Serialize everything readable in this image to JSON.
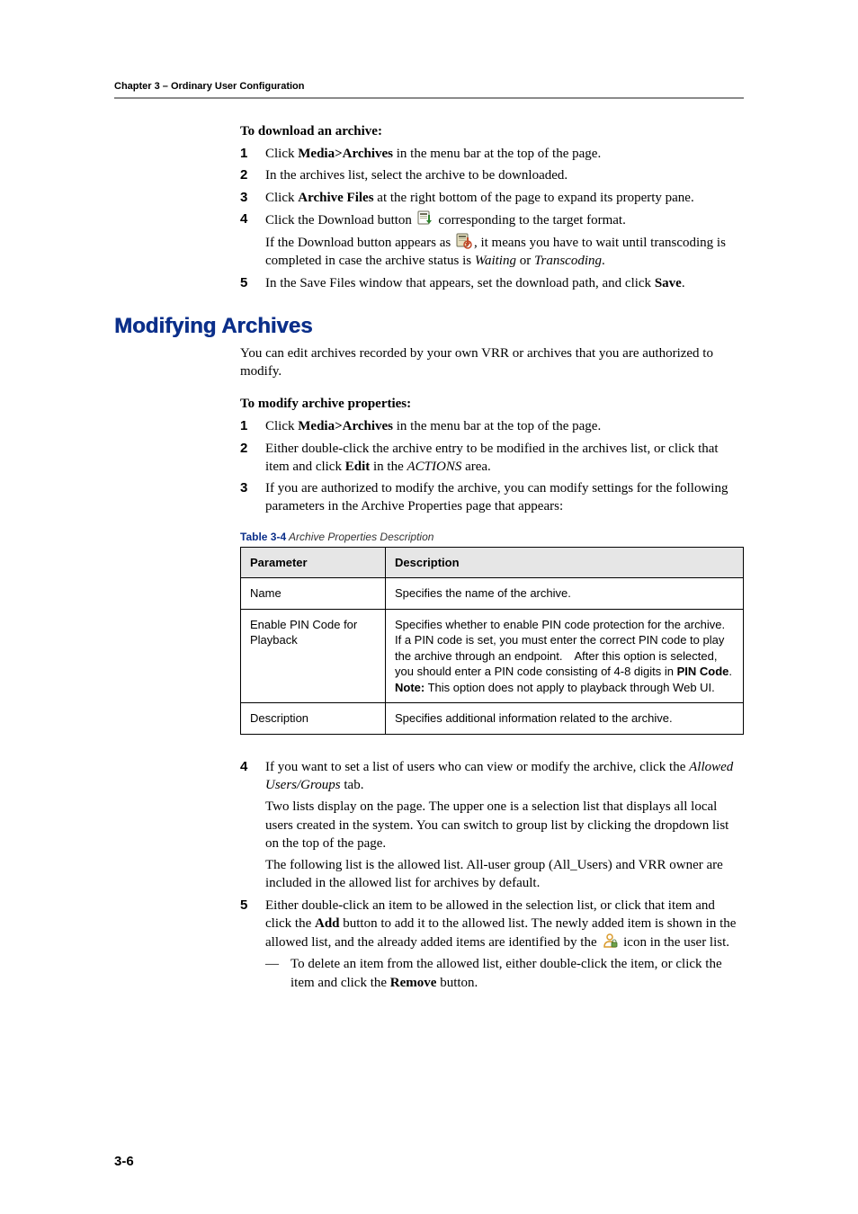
{
  "header": {
    "running": "Chapter 3 – Ordinary User Configuration"
  },
  "section1": {
    "lead": "To download an archive:",
    "steps": [
      {
        "num": "1",
        "html": "Click <b>Media>Archives</b> in the menu bar at the top of the page."
      },
      {
        "num": "2",
        "html": "In the archives list, select the archive to be downloaded."
      },
      {
        "num": "3",
        "html": "Click <b>Archive Files</b> at the right bottom of the page to expand its property pane."
      },
      {
        "num": "4",
        "html": "Click the Download button {DL_ICON} corresponding to the target format.",
        "extra": "If the Download button appears as {DL_DIS_ICON}, it means you have to wait until transcoding is completed in case the archive status is <i>Waiting</i> or <i>Transcoding</i>."
      },
      {
        "num": "5",
        "html": "In the Save Files window that appears, set the download path, and click <b>Save</b>."
      }
    ]
  },
  "section2": {
    "title": "Modifying Archives",
    "intro": "You can edit archives recorded by your own VRR or archives that you are authorized to modify.",
    "lead": "To modify archive properties:",
    "steps_a": [
      {
        "num": "1",
        "html": "Click <b>Media>Archives</b> in the menu bar at the top of the page."
      },
      {
        "num": "2",
        "html": "Either double-click the archive entry to be modified in the archives list, or click that item and click <b>Edit</b> in the <i>ACTIONS</i> area."
      },
      {
        "num": "3",
        "html": "If you are authorized to modify the archive, you can modify settings for the following parameters in the Archive Properties page that appears:"
      }
    ],
    "table": {
      "caption_strong": "Table 3-4",
      "caption_rest": " Archive Properties Description",
      "headers": [
        "Parameter",
        "Description"
      ],
      "rows": [
        [
          "Name",
          "Specifies the name of the archive."
        ],
        [
          "Enable PIN Code for Playback",
          "Specifies whether to enable PIN code protection for the archive. If a PIN code is set, you must enter the correct PIN code to play the archive through an endpoint. After this option is selected, you should enter a PIN code consisting of 4-8 digits in <b>PIN Code</b>.<br><b>Note:</b> This option does not apply to playback through Web UI."
        ],
        [
          "Description",
          "Specifies additional information related to the archive."
        ]
      ]
    },
    "steps_b": [
      {
        "num": "4",
        "html": "If you want to set a list of users who can view or modify the archive, click the <i>Allowed Users/Groups</i> tab.",
        "extras": [
          "Two lists display on the page. The upper one is a selection list that displays all local users created in the system. You can switch to group list by clicking the dropdown list on the top of the page.",
          "The following list is the allowed list. All-user group (All_Users) and VRR owner are included in the allowed list for archives by default."
        ]
      },
      {
        "num": "5",
        "html": "Either double-click an item to be allowed in the selection list, or click that item and click the <b>Add</b> button to add it to the allowed list. The newly added item is shown in the allowed list, and the already added items are identified by the {USER_ICON} icon in the user list.",
        "dash": "To delete an item from the allowed list, either double-click the item, or click the item and click the <b>Remove</b> button."
      }
    ]
  },
  "footer": {
    "page": "3-6"
  },
  "icons": {
    "download": "download-icon",
    "download_disabled": "download-disabled-icon",
    "user": "user-lock-icon"
  }
}
